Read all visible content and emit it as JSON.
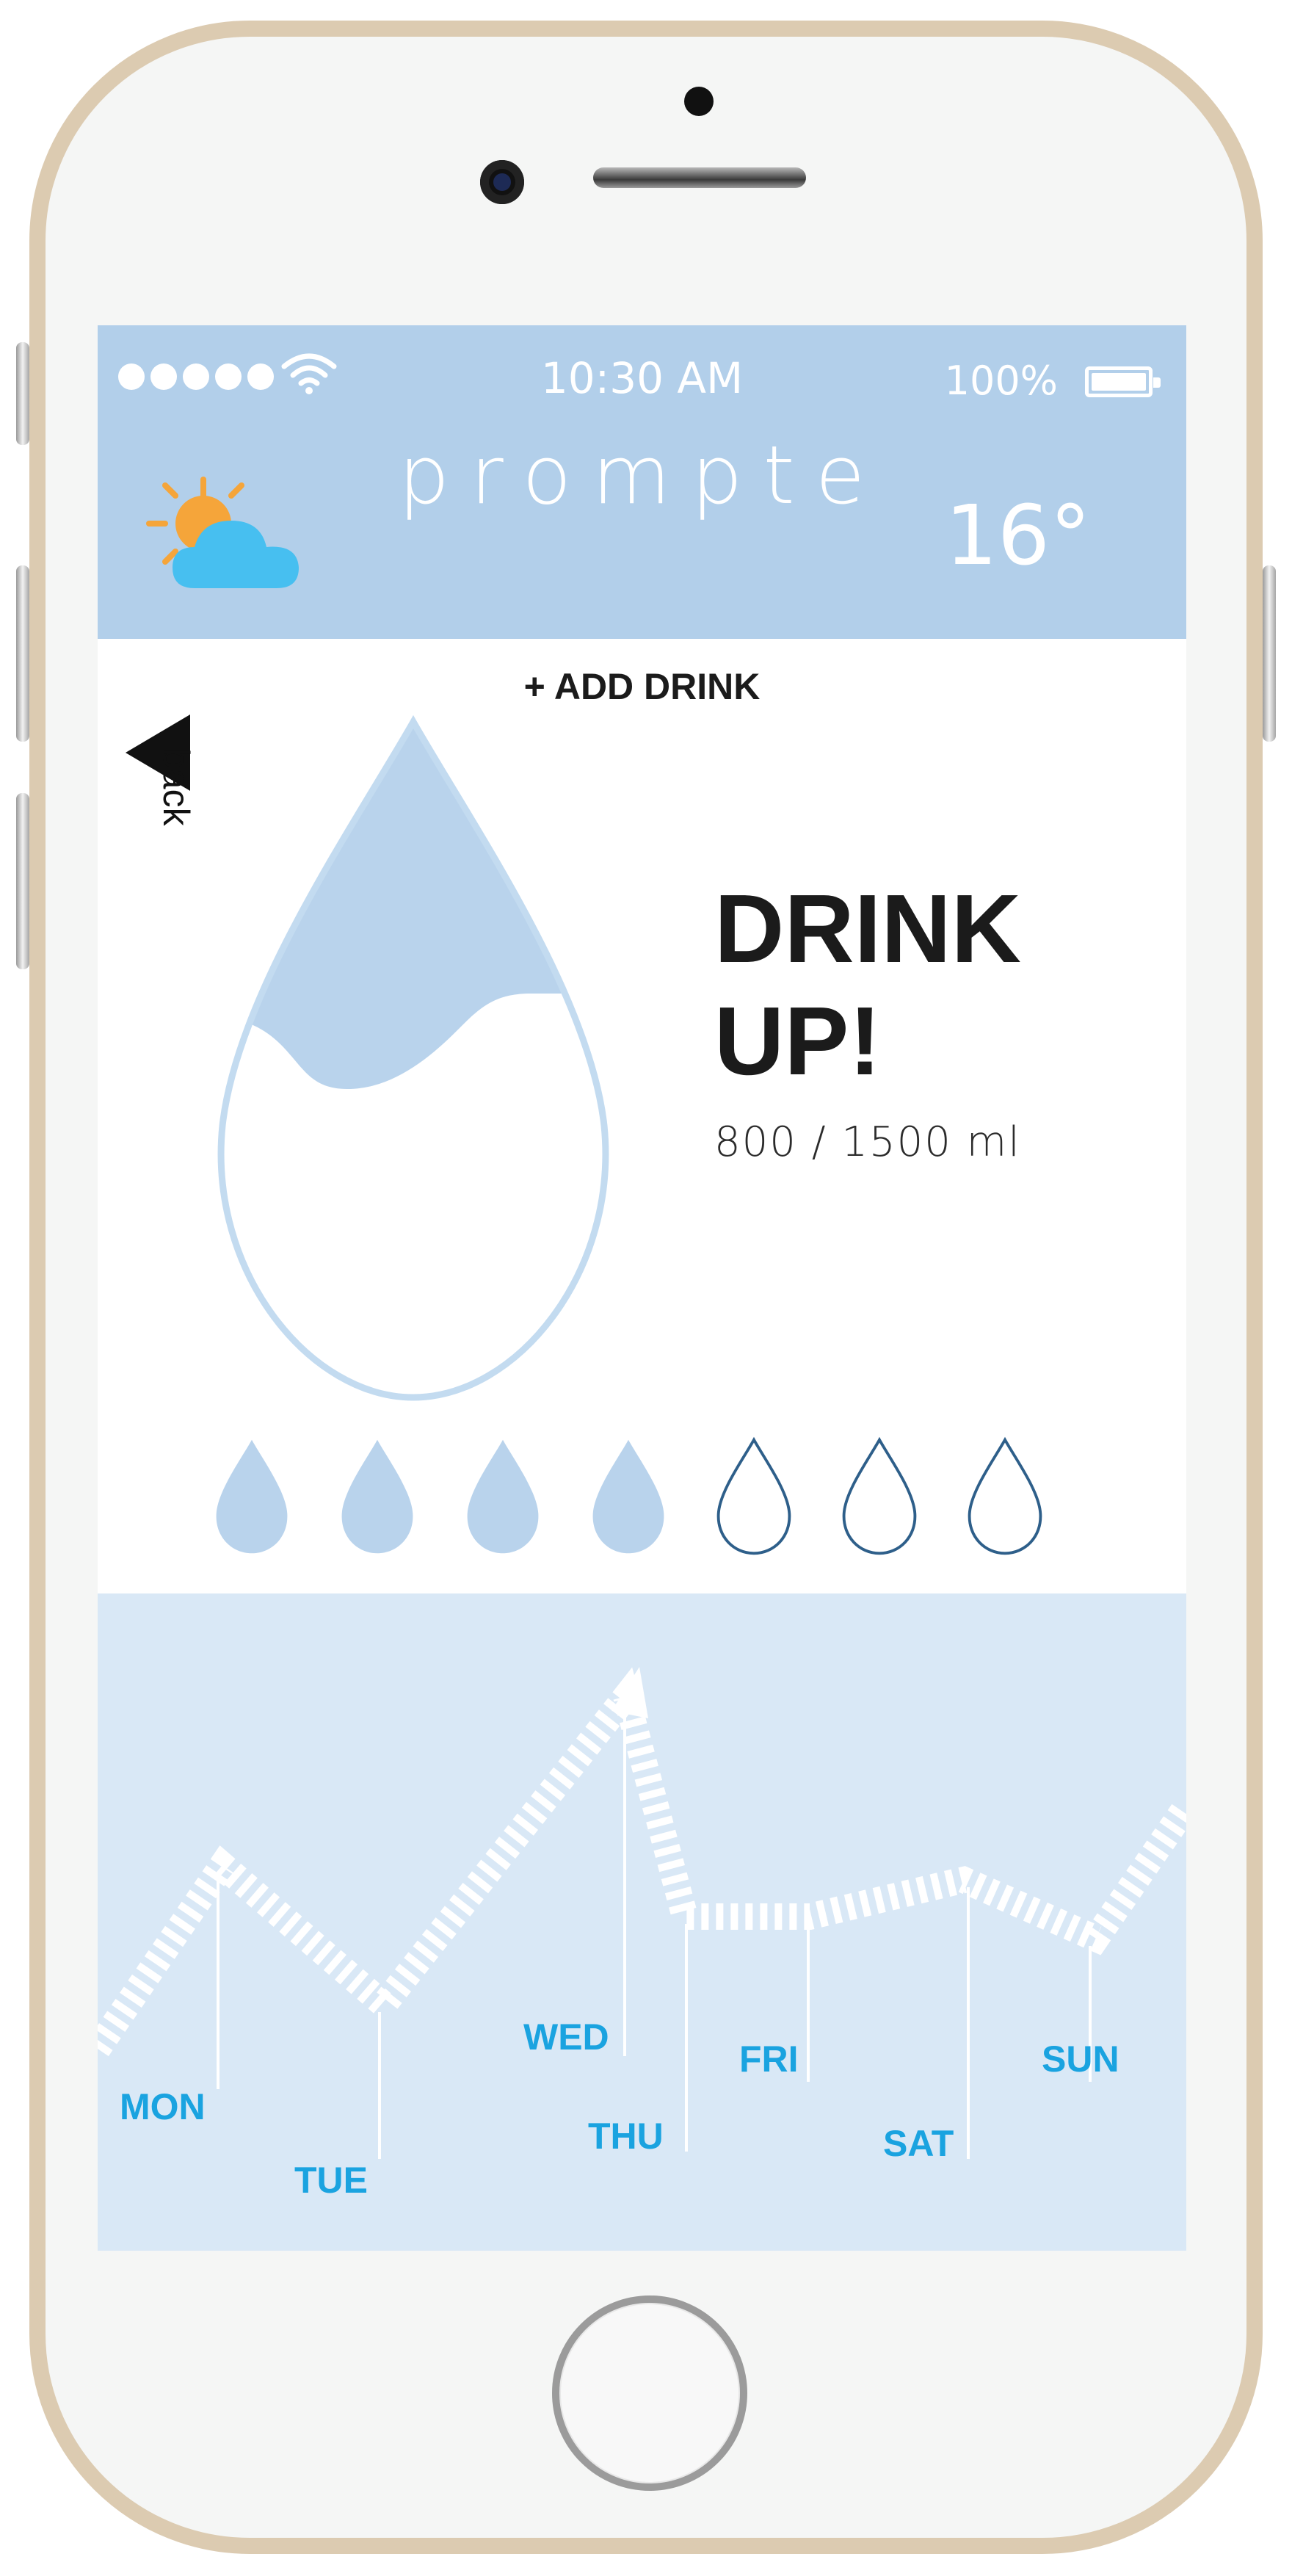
{
  "status_bar": {
    "signal_dots": 5,
    "time": "10:30 AM",
    "battery_percent": "100%",
    "battery_level": 1.0
  },
  "header": {
    "app_name": "prompte",
    "temperature": "16°",
    "weather_icon": "partly-cloudy-icon"
  },
  "actions": {
    "add_drink": "+ ADD DRINK",
    "back": "back"
  },
  "hydration": {
    "headline_line1": "DRINK",
    "headline_line2": "UP!",
    "progress_text": "800 / 1500 ml",
    "consumed_ml": 800,
    "goal_ml": 1500
  },
  "glasses": {
    "filled": 4,
    "total": 7
  },
  "week": {
    "days": [
      "MON",
      "TUE",
      "WED",
      "THU",
      "FRI",
      "SAT",
      "SUN"
    ]
  },
  "colors": {
    "header_bg": "#b2cfea",
    "drop_fill": "#b9d3ec",
    "drop_outline": "#2e5f8a",
    "week_bg": "#d9e8f6",
    "day_label": "#1aa3e0",
    "phone_frame": "#dccbb1"
  }
}
